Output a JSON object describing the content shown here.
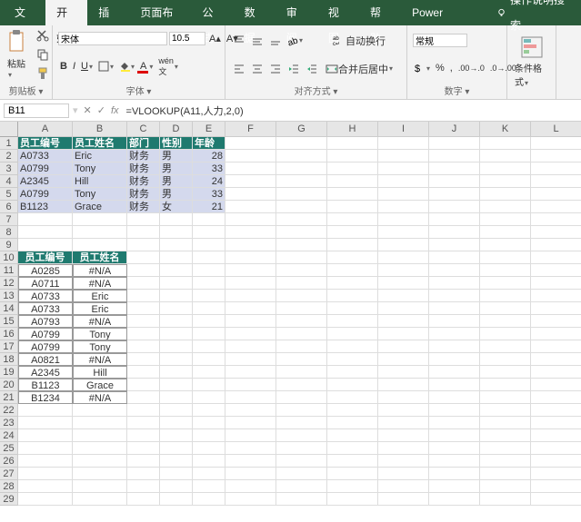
{
  "tabs": {
    "t0": "文件",
    "t1": "开始",
    "t2": "插入",
    "t3": "页面布局",
    "t4": "公式",
    "t5": "数据",
    "t6": "审阅",
    "t7": "视图",
    "t8": "帮助",
    "t9": "Power Pivot",
    "tell": "操作说明搜索"
  },
  "ribbon": {
    "clip": {
      "paste": "粘贴",
      "label": "剪贴板"
    },
    "font": {
      "name": "宋体",
      "size": "10.5",
      "label": "字体"
    },
    "align": {
      "wrap": "自动换行",
      "merge": "合并后居中",
      "label": "对齐方式"
    },
    "num": {
      "fmt": "常规",
      "label": "数字"
    },
    "style": {
      "cond": "条件格式"
    }
  },
  "namebox": "B11",
  "formula": "=VLOOKUP(A11,人力,2,0)",
  "headers": [
    "A",
    "B",
    "C",
    "D",
    "E",
    "F",
    "G",
    "H",
    "I",
    "J",
    "K",
    "L"
  ],
  "t1": {
    "h": [
      "员工编号",
      "员工姓名",
      "部门",
      "性别",
      "年龄"
    ],
    "r": [
      [
        "A0733",
        "Eric",
        "财务",
        "男",
        "28"
      ],
      [
        "A0799",
        "Tony",
        "财务",
        "男",
        "33"
      ],
      [
        "A2345",
        "Hill",
        "财务",
        "男",
        "24"
      ],
      [
        "A0799",
        "Tony",
        "财务",
        "男",
        "33"
      ],
      [
        "B1123",
        "Grace",
        "财务",
        "女",
        "21"
      ]
    ]
  },
  "t2": {
    "h": [
      "员工编号",
      "员工姓名"
    ],
    "r": [
      [
        "A0285",
        "#N/A"
      ],
      [
        "A0711",
        "#N/A"
      ],
      [
        "A0733",
        "Eric"
      ],
      [
        "A0733",
        "Eric"
      ],
      [
        "A0793",
        "#N/A"
      ],
      [
        "A0799",
        "Tony"
      ],
      [
        "A0799",
        "Tony"
      ],
      [
        "A0821",
        "#N/A"
      ],
      [
        "A2345",
        "Hill"
      ],
      [
        "B1123",
        "Grace"
      ],
      [
        "B1234",
        "#N/A"
      ]
    ]
  }
}
